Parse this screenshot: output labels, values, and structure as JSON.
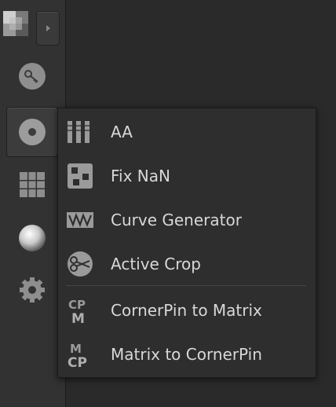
{
  "toolbar": {
    "items": [
      {
        "name": "color-swatch-icon"
      },
      {
        "name": "expand-arrow-icon"
      },
      {
        "name": "keyer-icon"
      },
      {
        "name": "filter-icon"
      },
      {
        "name": "grid-icon"
      },
      {
        "name": "sphere-icon"
      },
      {
        "name": "gear-icon"
      }
    ]
  },
  "menu": {
    "items": [
      {
        "label": "AA",
        "icon": "aa-bars-icon"
      },
      {
        "label": "Fix NaN",
        "icon": "fix-nan-icon"
      },
      {
        "label": "Curve Generator",
        "icon": "curve-generator-icon"
      },
      {
        "label": "Active Crop",
        "icon": "active-crop-icon"
      },
      {
        "label": "CornerPin to Matrix",
        "icon": "cornerpin-to-matrix-icon"
      },
      {
        "label": "Matrix to CornerPin",
        "icon": "matrix-to-cornerpin-icon"
      }
    ]
  },
  "colors": {
    "toolbar_bg": "#323232",
    "menu_bg": "#2e2e2e",
    "menu_text": "#d8d8d8",
    "icon_gray": "#9a9a9a"
  }
}
